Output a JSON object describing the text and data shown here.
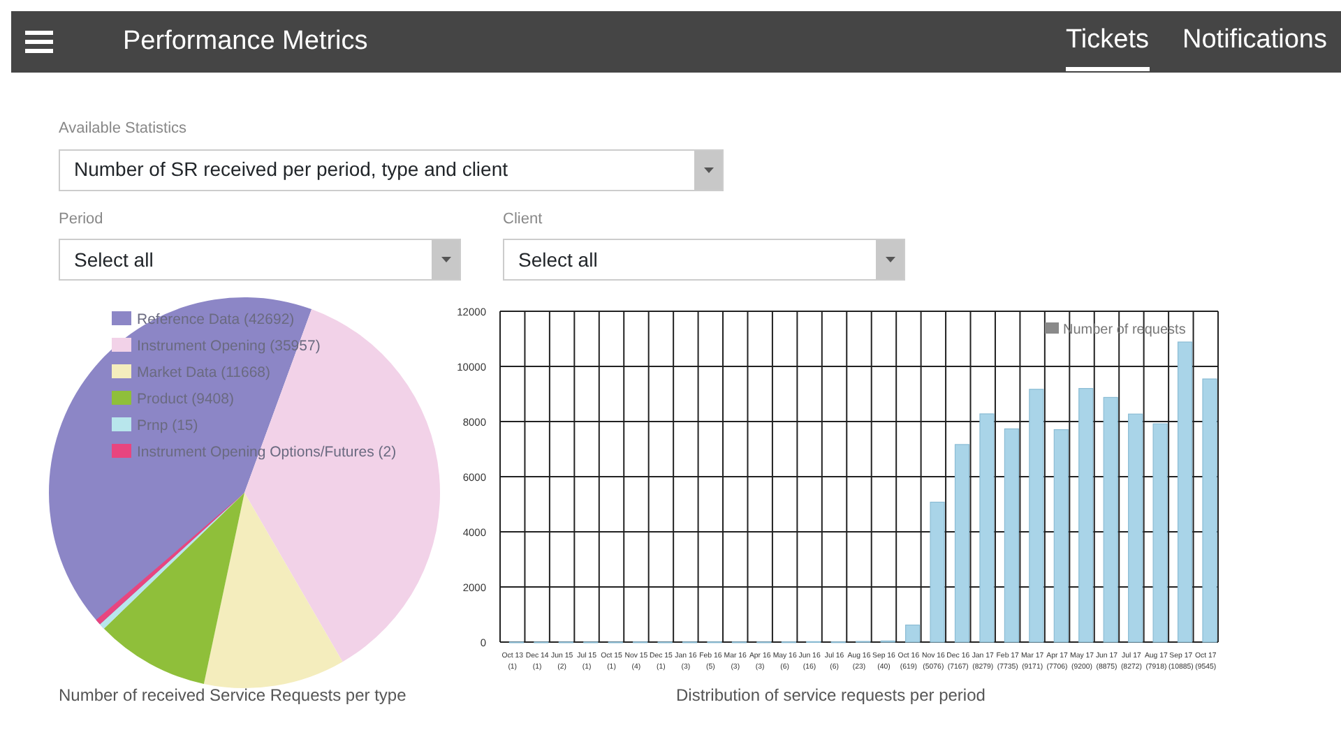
{
  "navbar": {
    "title": "Performance Metrics",
    "tabs": [
      {
        "label": "Tickets",
        "selected": true
      },
      {
        "label": "Notifications",
        "selected": false
      }
    ]
  },
  "filters": [
    {
      "label": "Available Statistics",
      "value": "Number of SR received per period, type and client",
      "kind": "wide"
    },
    {
      "label": "Period",
      "value": "Select all",
      "kind": "narrow"
    },
    {
      "label": "Client",
      "value": "Select all",
      "kind": "narrow"
    }
  ],
  "pie": {
    "caption": "Number of received Service Requests per type",
    "chart_data": {
      "type": "pie",
      "categories": [
        "Reference Data (42692)",
        "Instrument Opening (35957)",
        "Market Data (11668)",
        "Product (9408)",
        "Prnp (15)",
        "Instrument Opening Options/Futures (2)"
      ],
      "values": [
        42692,
        35957,
        11668,
        9408,
        15,
        2
      ],
      "colors": [
        "#8c86c6",
        "#f2d2e8",
        "#f4edbd",
        "#8fbf3a",
        "#b8e6ec",
        "#e8457f"
      ],
      "legend": true
    }
  },
  "bars": {
    "caption": "Distribution of service requests per period",
    "chart_data": {
      "type": "bar",
      "categories": [
        "Oct 13",
        "Dec 14",
        "Jun 15",
        "Jul 15",
        "Oct 15",
        "Nov 15",
        "Dec 15",
        "Jan 16",
        "Feb 16",
        "Mar 16",
        "Apr 16",
        "May 16",
        "Jun 16",
        "Jul 16",
        "Aug 16",
        "Sep 16",
        "Oct 16",
        "Nov 16",
        "Dec 16",
        "Jan 17",
        "Feb 17",
        "Mar 17",
        "Apr 17",
        "May 17",
        "Jun 17",
        "Jul 17",
        "Aug 17",
        "Sep 17",
        "Oct 17"
      ],
      "value_labels": [
        "(1)",
        "(1)",
        "(2)",
        "(1)",
        "(1)",
        "(4)",
        "(1)",
        "(3)",
        "(5)",
        "(3)",
        "(3)",
        "(6)",
        "(16)",
        "(6)",
        "(23)",
        "(40)",
        "(619)",
        "(5076)",
        "(7167)",
        "(8279)",
        "(7735)",
        "(9171)",
        "(7706)",
        "(9200)",
        "(8875)",
        "(8272)",
        "(7918)",
        "(10885)",
        "(9545)"
      ],
      "series": [
        {
          "name": "Number of requests",
          "color": "#a9d4e8",
          "values": [
            1,
            1,
            2,
            1,
            1,
            4,
            1,
            3,
            5,
            3,
            3,
            6,
            16,
            6,
            23,
            40,
            619,
            5076,
            7167,
            8279,
            7735,
            9171,
            7706,
            9200,
            8875,
            8272,
            7918,
            10885,
            9545
          ]
        }
      ],
      "grid": true,
      "legend": true,
      "ylim": [
        0,
        12000
      ],
      "yticks": [
        0,
        2000,
        4000,
        6000,
        8000,
        10000,
        12000
      ]
    }
  }
}
